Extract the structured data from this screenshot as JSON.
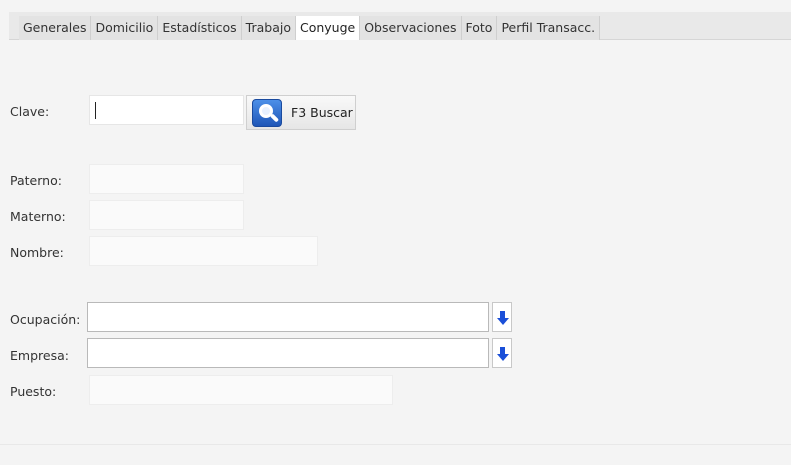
{
  "tabs": [
    {
      "label": "Generales",
      "active": false
    },
    {
      "label": "Domicilio",
      "active": false
    },
    {
      "label": "Estadísticos",
      "active": false
    },
    {
      "label": "Trabajo",
      "active": false
    },
    {
      "label": "Conyuge",
      "active": true
    },
    {
      "label": "Observaciones",
      "active": false
    },
    {
      "label": "Foto",
      "active": false
    },
    {
      "label": "Perfil Transacc.",
      "active": false
    }
  ],
  "form": {
    "clave_label": "Clave:",
    "clave_value": "",
    "buscar_label": "F3 Buscar",
    "paterno_label": "Paterno:",
    "paterno_value": "",
    "materno_label": "Materno:",
    "materno_value": "",
    "nombre_label": "Nombre:",
    "nombre_value": "",
    "ocupacion_label": "Ocupación:",
    "ocupacion_value": "",
    "empresa_label": "Empresa:",
    "empresa_value": "",
    "puesto_label": "Puesto:",
    "puesto_value": ""
  },
  "icons": {
    "search": "search-icon",
    "dropdown": "arrow-down-icon"
  },
  "colors": {
    "icon_blue": "#1a4fd8",
    "active_tab": "#ffffff"
  }
}
